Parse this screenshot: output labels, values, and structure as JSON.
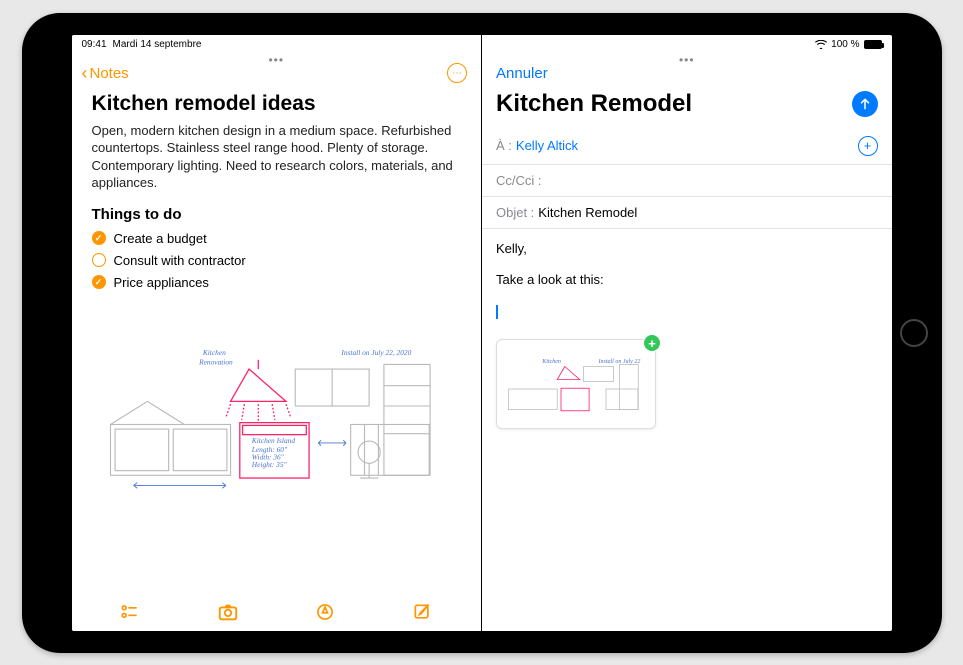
{
  "status": {
    "time": "09:41",
    "date": "Mardi 14 septembre",
    "battery": "100 %"
  },
  "notes": {
    "back_label": "Notes",
    "title": "Kitchen remodel ideas",
    "body": "Open, modern kitchen design in a medium space. Refurbished countertops. Stainless steel range hood. Plenty of storage. Contemporary lighting. Need to research colors, materials, and appliances.",
    "todo_heading": "Things to do",
    "todos": [
      {
        "label": "Create a budget",
        "done": true
      },
      {
        "label": "Consult with contractor",
        "done": false
      },
      {
        "label": "Price appliances",
        "done": true
      }
    ]
  },
  "mail": {
    "cancel": "Annuler",
    "title": "Kitchen Remodel",
    "to_label": "À :",
    "to_value": "Kelly Altick",
    "cc_label": "Cc/Cci :",
    "subject_label": "Objet :",
    "subject_value": "Kitchen Remodel",
    "body_greeting": "Kelly,",
    "body_line": "Take a look at this:"
  }
}
